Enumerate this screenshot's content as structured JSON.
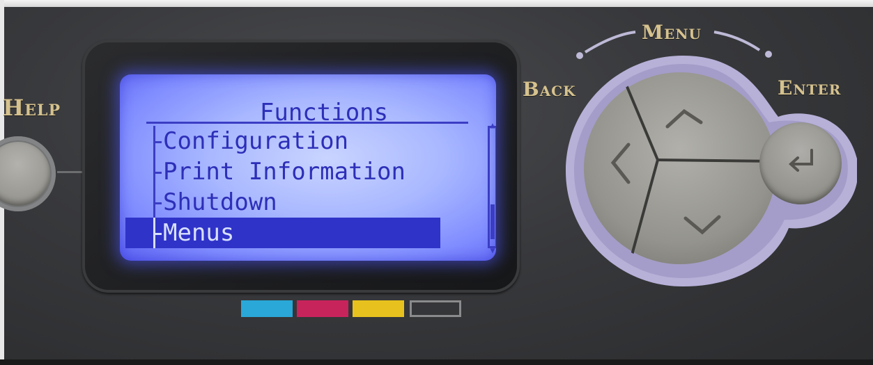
{
  "panel": {
    "help_label": "Help",
    "back_label": "Back",
    "menu_label": "Menu",
    "enter_label": "Enter"
  },
  "lcd": {
    "title": "Functions",
    "items": [
      {
        "label": "Configuration",
        "selected": false
      },
      {
        "label": "Print Information",
        "selected": false
      },
      {
        "label": "Shutdown",
        "selected": false
      },
      {
        "label": "Menus",
        "selected": true
      }
    ]
  },
  "toner_indicators": [
    {
      "name": "cyan",
      "color": "#2aa8d8"
    },
    {
      "name": "magenta",
      "color": "#c8245c"
    },
    {
      "name": "yellow",
      "color": "#e7c21e"
    },
    {
      "name": "black",
      "color": "empty"
    }
  ],
  "colors": {
    "lcd_backlight": "#8f9cff",
    "lcd_text": "#2d2fb8",
    "nav_ring": "#b7b1d8",
    "label": "#d6c28e"
  },
  "icons": [
    "up-arrow-icon",
    "down-arrow-icon",
    "left-arrow-icon",
    "enter-return-icon"
  ]
}
